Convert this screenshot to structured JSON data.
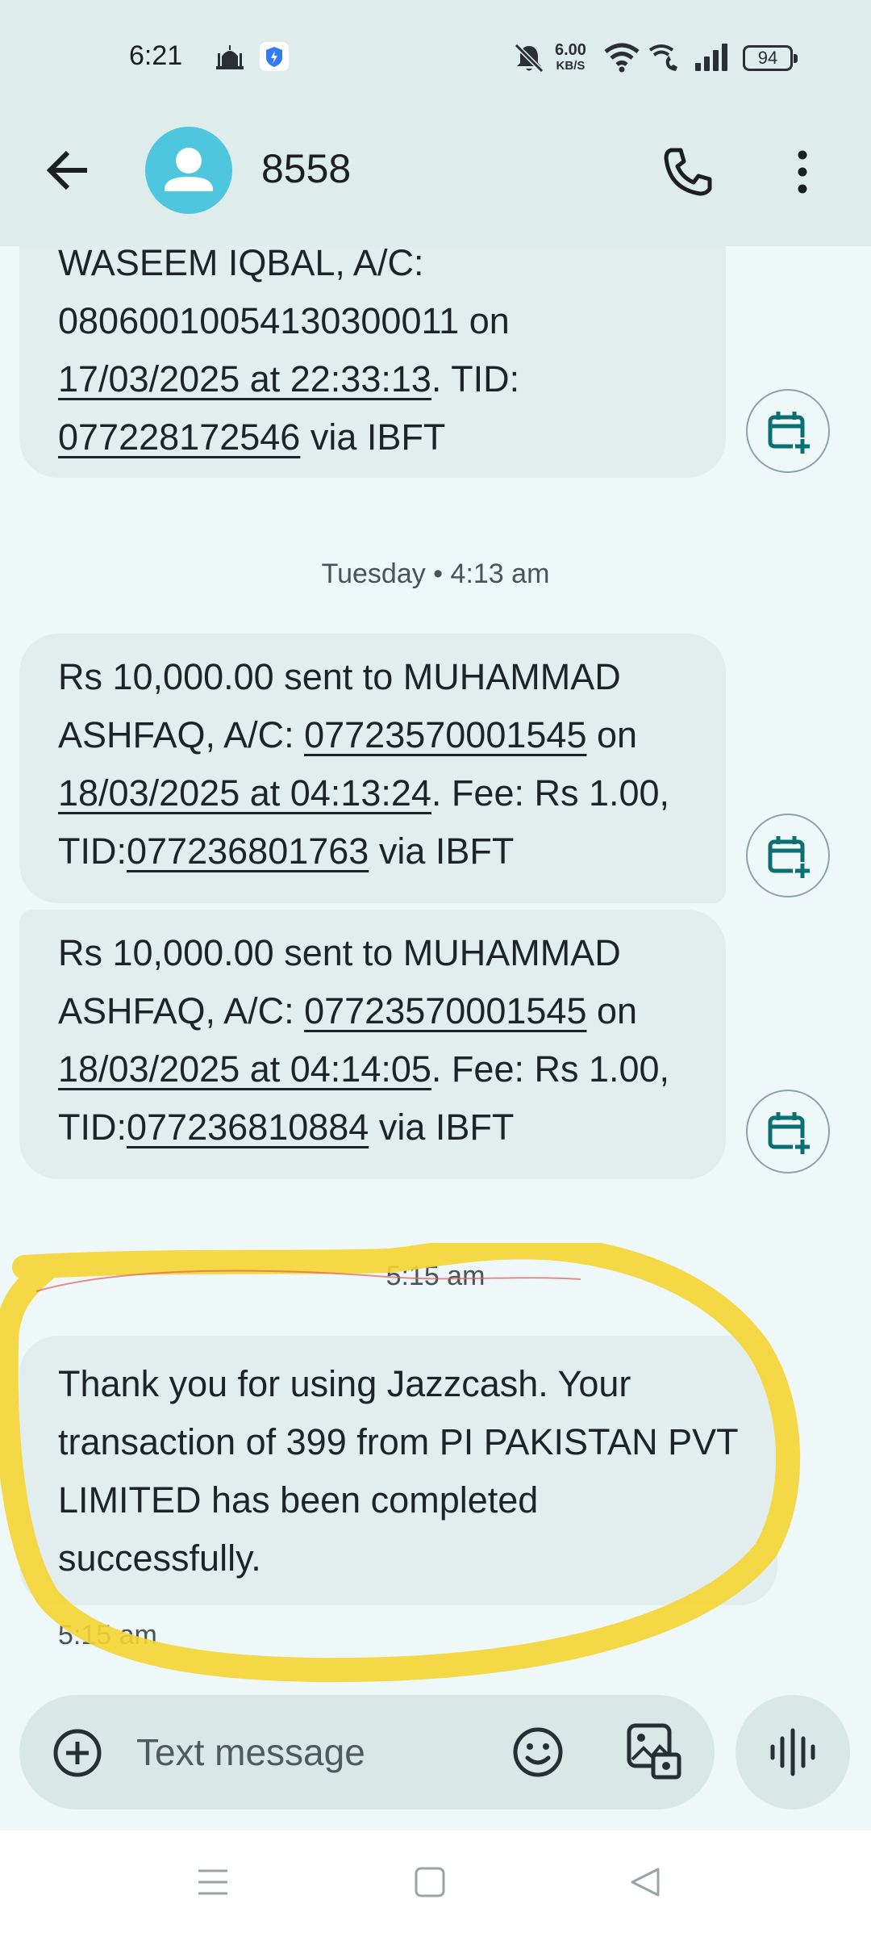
{
  "status_bar": {
    "time": "6:21",
    "net_speed_value": "6.00",
    "net_speed_unit": "KB/S",
    "battery": "94",
    "icons": [
      "mosque-icon",
      "shield-app-icon",
      "mute-bell-icon",
      "wifi-icon",
      "wifi-calling-icon",
      "signal-icon",
      "battery-icon"
    ]
  },
  "header": {
    "contact": "8558",
    "icons": [
      "back-arrow-icon",
      "person-icon",
      "phone-icon",
      "more-vert-icon"
    ]
  },
  "messages": [
    {
      "parts": [
        {
          "text": "WASEEM IQBAL, A/C: 0806001005413030001​1 on "
        },
        {
          "text": "17/03/2025 at 22:33:13",
          "link": true
        },
        {
          "text": ". TID: "
        },
        {
          "text": "077228172546",
          "link": true
        },
        {
          "text": " via IBFT"
        }
      ]
    }
  ],
  "msg1": {
    "line1": "WASEEM IQBAL, A/C:",
    "line2": "08060010054130300011 on",
    "date": "17/03/2025 at 22:33:13",
    "after_date": ". TID:",
    "tid": "077228172546",
    "tail": " via IBFT"
  },
  "separator1": "Tuesday • 4:13 am",
  "msg2": {
    "lead": "Rs 10,000.00 sent to MUHAMMAD ASHFAQ, A/C: ",
    "acct": "07723570001545",
    "on": " on",
    "date": "18/03/2025 at 04:13:24",
    "fee": ". Fee: Rs 1.00,  TID:",
    "tid": "077236801763",
    "tail": " via IBFT"
  },
  "msg3": {
    "lead": "Rs 10,000.00 sent to MUHAMMAD ASHFAQ, A/C: ",
    "acct": "07723570001545",
    "on": " on",
    "date": "18/03/2025 at 04:14:05",
    "fee": ". Fee: Rs 1.00,  TID:",
    "tid": "077236810884",
    "tail": " via IBFT"
  },
  "separator2": "5:15 am",
  "msg4": {
    "text": "Thank you for using Jazzcash. Your transaction of 399 from PI PAKISTAN PVT LIMITED has been completed successfully.",
    "time": "5:15 am"
  },
  "compose": {
    "placeholder": "Text message",
    "icons": [
      "add-icon",
      "emoji-icon",
      "gallery-icon",
      "voice-icon"
    ]
  },
  "nav": {
    "icons": [
      "menu-icon",
      "home-icon",
      "back-icon"
    ]
  },
  "colors": {
    "background": "#eef8f8",
    "bubble": "#e2eeee",
    "appbar": "#dfecec",
    "avatar": "#4ec6de",
    "accent_teal": "#0b6f73",
    "highlight": "#f5d431"
  }
}
